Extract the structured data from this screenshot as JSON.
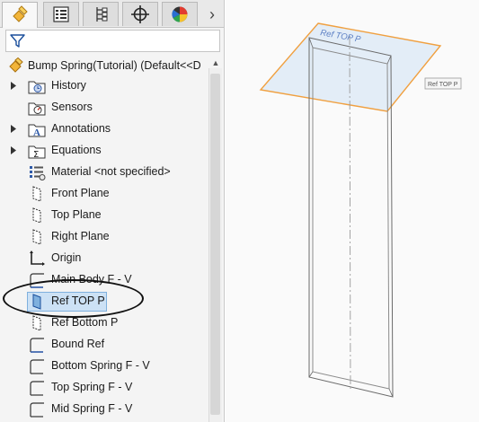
{
  "tabs": [
    {
      "name": "feature-manager",
      "icon": "feature-tree-icon"
    },
    {
      "name": "property-manager",
      "icon": "property-list-icon"
    },
    {
      "name": "configuration-manager",
      "icon": "configuration-icon"
    },
    {
      "name": "dimxpert-manager",
      "icon": "crosshair-icon"
    },
    {
      "name": "display-manager",
      "icon": "appearance-sphere-icon"
    }
  ],
  "tab_more_glyph": "›",
  "filter": {
    "icon": "funnel-icon",
    "value": ""
  },
  "tree": {
    "root_label": "Bump Spring(Tutorial)  (Default<<D",
    "items": [
      {
        "label": "History",
        "icon": "history-folder-icon",
        "expandable": true
      },
      {
        "label": "Sensors",
        "icon": "sensors-folder-icon",
        "expandable": false
      },
      {
        "label": "Annotations",
        "icon": "annotations-folder-icon",
        "expandable": true
      },
      {
        "label": "Equations",
        "icon": "equations-folder-icon",
        "expandable": true
      },
      {
        "label": "Material <not specified>",
        "icon": "material-icon",
        "expandable": false
      },
      {
        "label": "Front Plane",
        "icon": "plane-icon",
        "expandable": false
      },
      {
        "label": "Top Plane",
        "icon": "plane-icon",
        "expandable": false
      },
      {
        "label": "Right Plane",
        "icon": "plane-icon",
        "expandable": false
      },
      {
        "label": "Origin",
        "icon": "origin-icon",
        "expandable": false
      },
      {
        "label": "Main Body F - V",
        "icon": "sketch-icon",
        "expandable": false
      },
      {
        "label": "Ref TOP P",
        "icon": "plane-icon",
        "expandable": false,
        "selected": true
      },
      {
        "label": "Ref Bottom P",
        "icon": "plane-icon",
        "expandable": false
      },
      {
        "label": "Bound Ref",
        "icon": "sketch-icon",
        "expandable": false
      },
      {
        "label": "Bottom Spring F - V",
        "icon": "sketch-icon",
        "expandable": false
      },
      {
        "label": "Top Spring F - V",
        "icon": "sketch-icon",
        "expandable": false
      },
      {
        "label": "Mid Spring F - V",
        "icon": "sketch-icon",
        "expandable": false
      }
    ]
  },
  "viewport": {
    "plane_label": "Ref TOP P",
    "plane_tag": "Ref TOP P",
    "colors": {
      "plane_edge": "#f0a040",
      "plane_fill": "#dbe8f6",
      "plane_text": "#5b7fc4",
      "body_edge": "#6a6a6a",
      "selection": "#cce1f5"
    }
  }
}
